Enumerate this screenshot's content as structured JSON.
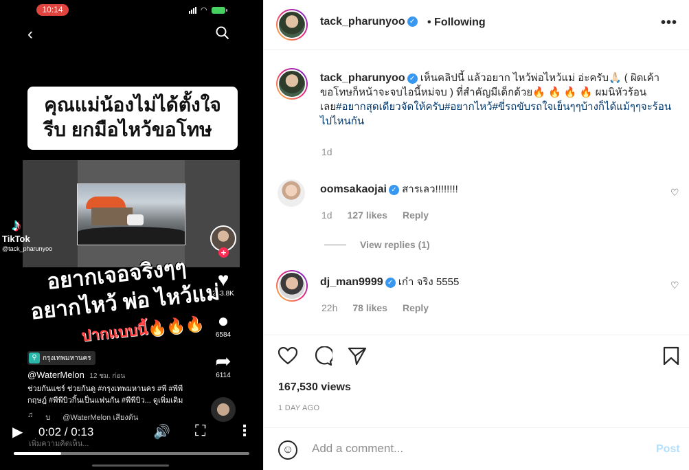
{
  "video": {
    "status_time": "10:14",
    "caption_line1": "คุณแม่น้องไม่ได้ตั้งใจจึง",
    "caption_line2": "รีบ ยกมือไหว้ขอโทษ",
    "tiktok_name": "TikTok",
    "tiktok_user": "@tack_pharunyoo",
    "like_count": "243.8K",
    "comment_count": "6584",
    "share_count": "6114",
    "overlay_line1": "อยากเจอจริงๆๆ",
    "overlay_line2": "อยากไหว้ พ่อ ไหว้แม่",
    "overlay_line3": "ปากแบบนี้🔥🔥🔥",
    "location_tag": "กรุงเทพมหานคร",
    "author": "@WaterMelon",
    "author_ago": "12 ชม. ก่อน",
    "desc_line1": "ช่วยกันแชร์ ช่วยกันดู #กรุงเทพมหานคร #พี #พีพี",
    "desc_line2": "กฤษฎ์ #พีพีบิวกิ้นเป็นแฟนกัน #พีพีบิว... ดูเพิ่มเติม",
    "sound_prefix": "บ",
    "sound_text": "@WaterMelon เสียงต้น",
    "time_display": "0:02 / 0:13",
    "progress": 0.2,
    "comment_hint": "เพิ่มความคิดเห็น...",
    "icons": [
      "back-icon",
      "search-icon",
      "play-icon",
      "volume-icon",
      "fullscreen-icon",
      "more-icon",
      "heart-icon",
      "comment-icon",
      "share-icon"
    ]
  },
  "post": {
    "username": "tack_pharunyoo",
    "follow_state": "Following",
    "more_label": "•••",
    "caption_text_1": "เห็นคลิปนี้ แล้วอยาก ไหว้พ่อไหว้แม่ อ่ะครับ🙏🏻 ( ผิดเค้าขอโทษก็หน้าจะจบไอนี้หม่จบ ) ที่สำคัญมีเด็กด้วย🔥 🔥 🔥 🔥 ผมนิหัวร้อนเลย",
    "caption_tags": "#อยากสุดเดียวจัดให้ครับ#อยากไหว้#ขี่รถขับรถใจเย็นๆๆบ้างก็ได้แม้ๆๆจะร้อนไปไหนกัน",
    "caption_age": "1d",
    "comments": [
      {
        "username": "oomsakaojai",
        "text": "สารเลว!!!!!!!!",
        "age": "1d",
        "likes": "127 likes",
        "reply": "Reply"
      },
      {
        "username": "dj_man9999",
        "text": "เก๋า จริง 5555",
        "age": "22h",
        "likes": "78 likes",
        "reply": "Reply"
      }
    ],
    "view_replies": "View replies (1)",
    "views": "167,530 views",
    "date": "1 DAY AGO",
    "comment_placeholder": "Add a comment...",
    "post_button": "Post",
    "accent": "#3897f0",
    "post_button_color": "#b2dffc"
  }
}
